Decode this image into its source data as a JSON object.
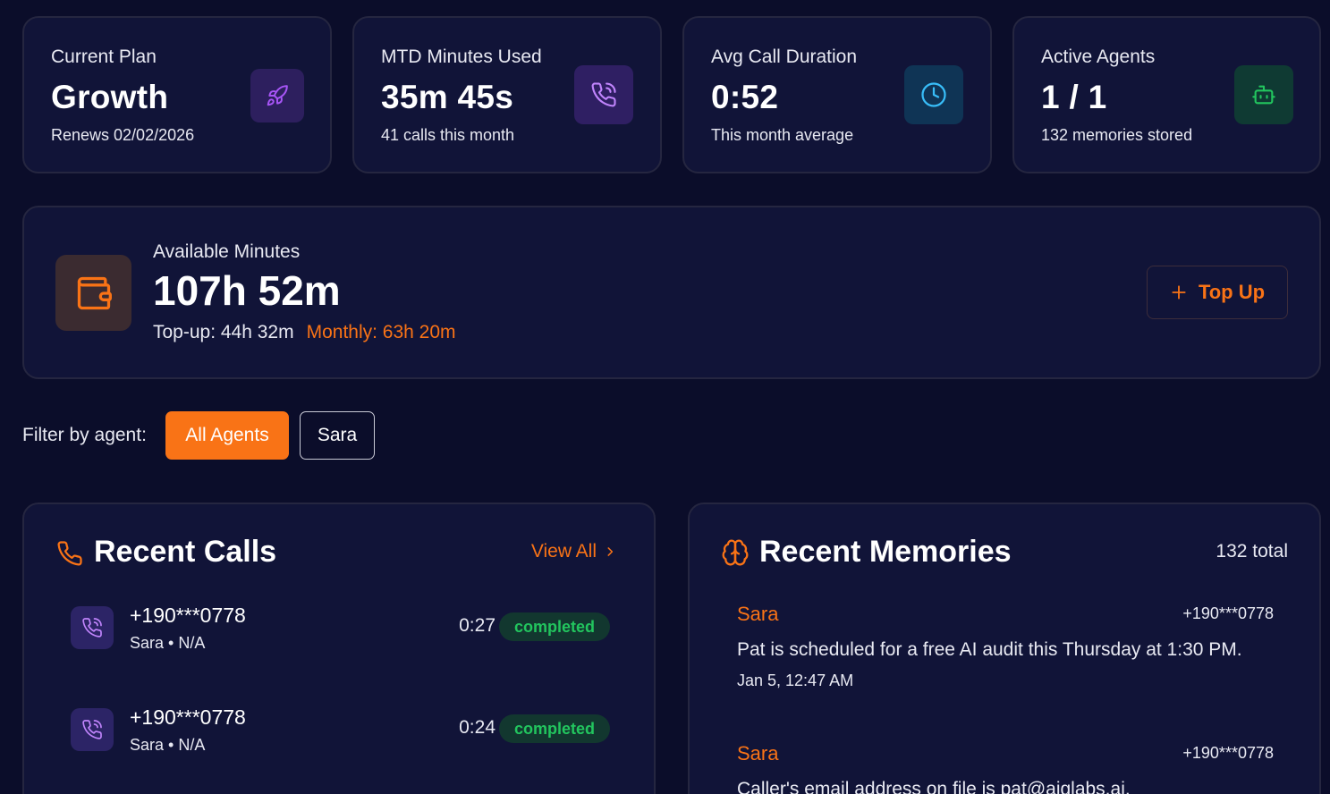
{
  "stats": [
    {
      "label": "Current Plan",
      "value": "Growth",
      "sub": "Renews 02/02/2026",
      "icon": "rocket-icon",
      "icon_color": "#a855f7",
      "icon_bg": "#2d1f5e"
    },
    {
      "label": "MTD Minutes Used",
      "value": "35m 45s",
      "sub": "41 calls this month",
      "icon": "phone-call-icon",
      "icon_color": "#c084fc",
      "icon_bg": "#2f1f63"
    },
    {
      "label": "Avg Call Duration",
      "value": "0:52",
      "sub": "This month average",
      "icon": "clock-icon",
      "icon_color": "#38bdf8",
      "icon_bg": "#0f3455"
    },
    {
      "label": "Active Agents",
      "value": "1 / 1",
      "sub": "132 memories stored",
      "icon": "bot-icon",
      "icon_color": "#22c55e",
      "icon_bg": "#0f3a33"
    }
  ],
  "minutes": {
    "label": "Available Minutes",
    "value": "107h 52m",
    "topup": "Top-up: 44h 32m",
    "monthly": "Monthly: 63h 20m",
    "button_label": "Top Up",
    "accent": "#f97316"
  },
  "filter": {
    "label": "Filter by agent:",
    "options": [
      "All Agents",
      "Sara"
    ],
    "selected": "All Agents"
  },
  "recent_calls": {
    "title": "Recent Calls",
    "view_all": "View All",
    "items": [
      {
        "number": "+190***0778",
        "meta": "Sara • N/A",
        "duration": "0:27",
        "status": "completed"
      },
      {
        "number": "+190***0778",
        "meta": "Sara • N/A",
        "duration": "0:24",
        "status": "completed"
      }
    ]
  },
  "recent_memories": {
    "title": "Recent Memories",
    "total": "132 total",
    "items": [
      {
        "agent": "Sara",
        "phone": "+190***0778",
        "text": "Pat is scheduled for a free AI audit this Thursday at 1:30 PM.",
        "date": "Jan 5, 12:47 AM"
      },
      {
        "agent": "Sara",
        "phone": "+190***0778",
        "text": "Caller's email address on file is pat@aiglabs.ai.",
        "date": ""
      }
    ]
  },
  "colors": {
    "background": "#0b0d2a",
    "card": "#111438",
    "accent": "#f97316",
    "success": "#22c55e"
  }
}
